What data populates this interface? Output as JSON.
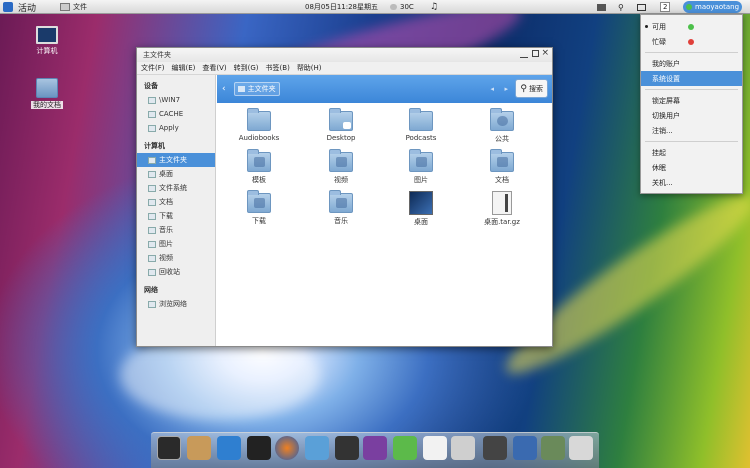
{
  "topbar": {
    "activities": "活动",
    "window_label": "文件",
    "datetime": "08月05日11:28星期五",
    "weather": "30C",
    "workspace_num": "2",
    "username": "maoyaotang"
  },
  "desktop": {
    "icons": [
      {
        "label": "计算机"
      },
      {
        "label": "我的文档"
      }
    ]
  },
  "window": {
    "title": "主文件夹",
    "menu": [
      "文件(F)",
      "编辑(E)",
      "查看(V)",
      "转到(G)",
      "书签(B)",
      "帮助(H)"
    ],
    "sidebar": {
      "devices_title": "设备",
      "devices": [
        "\\WIN7",
        "CACHE",
        "Apply"
      ],
      "computer_title": "计算机",
      "computer": [
        "主文件夹",
        "桌面",
        "文件系统",
        "文档",
        "下载",
        "音乐",
        "图片",
        "视频",
        "回收站"
      ],
      "network_title": "网络",
      "network": [
        "浏览网络"
      ]
    },
    "path_label": "主文件夹",
    "search_label": "搜索",
    "files": [
      "Audiobooks",
      "Desktop",
      "Podcasts",
      "公共",
      "模板",
      "视频",
      "图片",
      "文档",
      "下载",
      "音乐",
      "桌面",
      "桌面.tar.gz"
    ]
  },
  "user_menu": {
    "status_available": "可用",
    "status_busy": "忙碌",
    "items": [
      "我的账户",
      "系统设置",
      "锁定屏幕",
      "切换用户",
      "注销...",
      "挂起",
      "休眠",
      "关机..."
    ]
  },
  "colors": {
    "accent": "#4a90d9",
    "online": "#4cc04a",
    "busy": "#e0403a"
  }
}
